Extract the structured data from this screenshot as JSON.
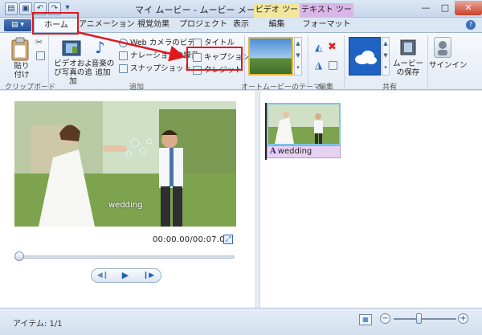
{
  "titlebar": {
    "title": "マイ ムービー - ムービー メーカー",
    "ctx_video": "ビデオ ツール",
    "ctx_text": "テキスト ツール",
    "minimize": "—",
    "maximize": "□",
    "close": "✕"
  },
  "tabs": {
    "home": "ホーム",
    "animation": "アニメーション",
    "visual": "視覚効果",
    "project": "プロジェクト",
    "view": "表示",
    "edit": "編集",
    "format": "フォーマット",
    "help": "?"
  },
  "ribbon": {
    "paste": "貼り付け",
    "clipboard_group": "クリップボード",
    "add_video_photo": "ビデオおよび写真の追加",
    "add_music": "音楽の追加",
    "webcam_video": "Web カメラのビデオ",
    "narration": "ナレーションの録音",
    "snapshot": "スナップショット",
    "add_group": "追加",
    "title_btn": "タイトル",
    "caption_btn": "キャプション",
    "credits_btn": "クレジット",
    "automovie_group": "オートムービーのテーマ",
    "edit_group": "編集",
    "save_movie": "ムービーの保存",
    "signin": "サインイン",
    "share_group": "共有"
  },
  "preview": {
    "overlay_text": "wedding",
    "timecode": "00:00.00/00:07.00",
    "seek_fraction": 0.0
  },
  "storyboard": {
    "clip_caption": "wedding"
  },
  "status": {
    "items": "アイテム: 1/1",
    "zoom_fraction": 0.4
  },
  "colors": {
    "highlight_red": "#e0181c",
    "ctx_video": "#f2e69a",
    "ctx_text": "#d9b6e8",
    "caption_bg": "#e6d1f2"
  }
}
